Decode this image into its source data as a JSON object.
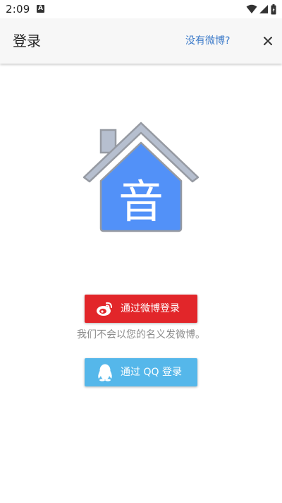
{
  "status_bar": {
    "time": "2:09",
    "notification_icon": "A"
  },
  "app_bar": {
    "title": "登录",
    "no_account_link": "没有微博?",
    "close_icon": "close-icon"
  },
  "logo": {
    "glyph": "音",
    "house_color": "#5291f8",
    "roof_color": "#b6bfcf"
  },
  "weibo_login": {
    "label": "通过微博登录",
    "color": "#e2262a",
    "icon": "weibo-icon"
  },
  "notice": "我们不会以您的名义发微博。",
  "qq_login": {
    "label": "通过 QQ 登录",
    "color": "#55b7ea",
    "icon": "qq-penguin-icon"
  }
}
